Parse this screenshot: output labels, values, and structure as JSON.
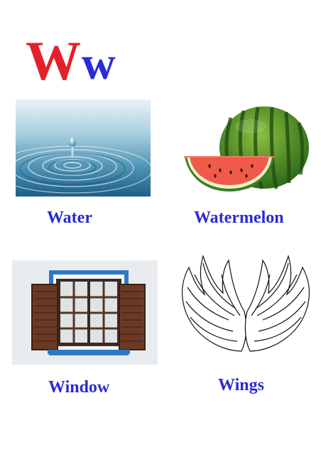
{
  "title": {
    "uppercase": "W",
    "lowercase": "w"
  },
  "colors": {
    "uppercase": "#e5202b",
    "lowercase": "#2a2ad8",
    "labels": "#2b2bd0"
  },
  "items": [
    {
      "label": "Water",
      "image": "water-drop-image"
    },
    {
      "label": "Watermelon",
      "image": "watermelon-image"
    },
    {
      "label": "Window",
      "image": "window-image"
    },
    {
      "label": "Wings",
      "image": "wings-image"
    }
  ]
}
